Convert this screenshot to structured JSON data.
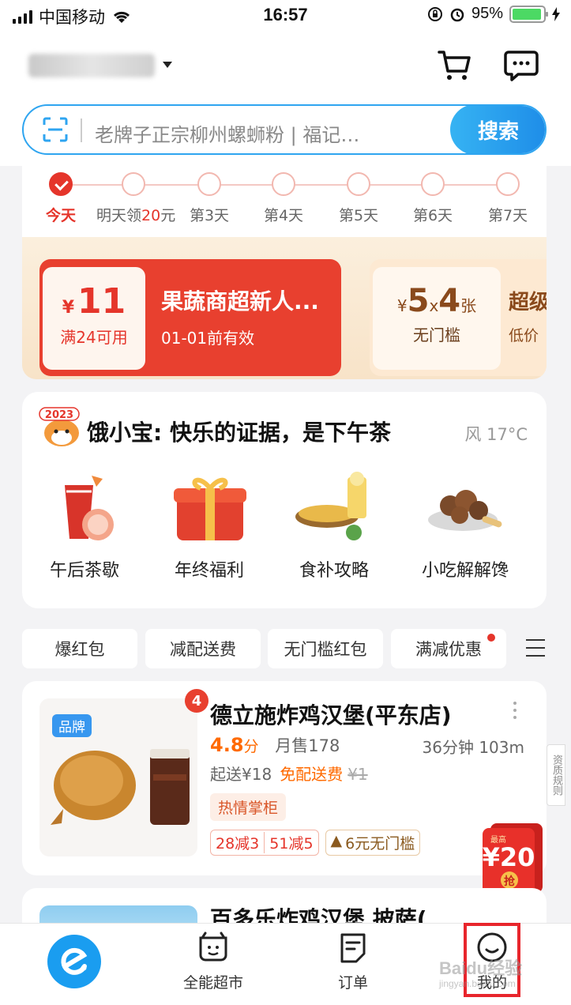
{
  "status_bar": {
    "carrier": "中国移动",
    "time": "16:57",
    "battery": "95%",
    "battery_level": 0.95
  },
  "header": {
    "search_placeholder": "老牌子正宗柳州螺蛳粉 | 福记…",
    "search_button": "搜索",
    "cart_icon": "cart-icon",
    "message_icon": "message-icon"
  },
  "day_track": [
    {
      "label": "今天",
      "active": true
    },
    {
      "label_prefix": "明天领",
      "label_red": "20",
      "label_suffix": "元"
    },
    {
      "label": "第3天"
    },
    {
      "label": "第4天"
    },
    {
      "label": "第5天"
    },
    {
      "label": "第6天"
    },
    {
      "label": "第7天"
    }
  ],
  "coupons": {
    "c1_currency": "¥",
    "c1_amount": "11",
    "c1_condition": "满24可用",
    "c1_title": "果蔬商超新人...",
    "c1_expiry": "01-01前有效",
    "c2_currency": "¥",
    "c2_amount": "5",
    "c2_times": "x",
    "c2_count": "4",
    "c2_unit": "张",
    "c2_condition": "无门槛",
    "c2_title": "超级",
    "c2_sub": "低价"
  },
  "weather_card": {
    "mascot_year": "2023",
    "title": "饿小宝: 快乐的证据，是下午茶",
    "weather": "风 17°C",
    "items": [
      {
        "label": "午后茶歇"
      },
      {
        "label": "年终福利"
      },
      {
        "label": "食补攻略"
      },
      {
        "label": "小吃解解馋"
      }
    ]
  },
  "filters": [
    "爆红包",
    "减配送费",
    "无门槛红包",
    "满减优惠"
  ],
  "store": {
    "brand_tag": "品牌",
    "badge": "4",
    "name": "德立施炸鸡汉堡(平东店)",
    "rating": "4.8",
    "rating_unit": "分",
    "monthly_sales": "月售178",
    "delivery": "36分钟 103m",
    "min_order": "起送¥18",
    "free_delivery": "免配送费",
    "original_fee": "¥1",
    "shop_tag": "热情掌柜",
    "promo_1a": "28减3",
    "promo_1b": "51减5",
    "promo_2": "6元无门槛",
    "qualify": "资质规则"
  },
  "red_packet": {
    "small": "最高",
    "amount": "¥20",
    "action": "抢"
  },
  "store2": {
    "name": "百多乐炸鸡汉堡 披萨("
  },
  "tab_bar": {
    "supermarket": "全能超市",
    "orders": "订单",
    "mine": "我的"
  },
  "watermark": {
    "text": "Baidu经验",
    "sub": "jingyan.baidu.com"
  },
  "colors": {
    "accent_blue": "#1a9df0",
    "accent_red": "#e5352b",
    "orange": "#ff6a00"
  }
}
